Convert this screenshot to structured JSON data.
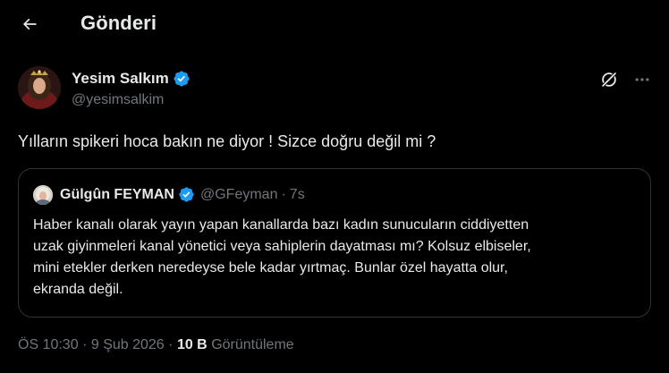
{
  "header": {
    "title": "Gönderi"
  },
  "tweet": {
    "author": {
      "display_name": "Yesim Salkım",
      "handle": "@yesimsalkim",
      "verified": true
    },
    "text": "Yılların spikeri hoca bakın ne diyor ! Sizce doğru değil mi ?",
    "time": "ÖS 10:30",
    "separator": "·",
    "date": "9 Şub 2026",
    "views_count": "10 B",
    "views_label": "Görüntüleme"
  },
  "quote": {
    "author": {
      "display_name": "Gülgûn FEYMAN",
      "handle": "@GFeyman",
      "verified": true
    },
    "separator": "·",
    "time": "7s",
    "text": "Haber kanalı olarak yayın yapan kanallarda  bazı kadın sunucuların ciddiyetten\nuzak giyinmeleri kanal yönetici veya sahiplerin dayatması mı? Kolsuz elbiseler,\nmini etekler derken neredeyse bele kadar yırtmaç. Bunlar özel hayatta olur,\nekranda değil."
  },
  "icons": {
    "back": "arrow-left-icon",
    "verified": "verified-badge-icon",
    "grok": "grok-icon",
    "more": "more-horizontal-icon"
  },
  "colors": {
    "background": "#000000",
    "text": "#e7e9ea",
    "muted": "#71767b",
    "verified": "#1d9bf0",
    "border": "#2f3336"
  }
}
